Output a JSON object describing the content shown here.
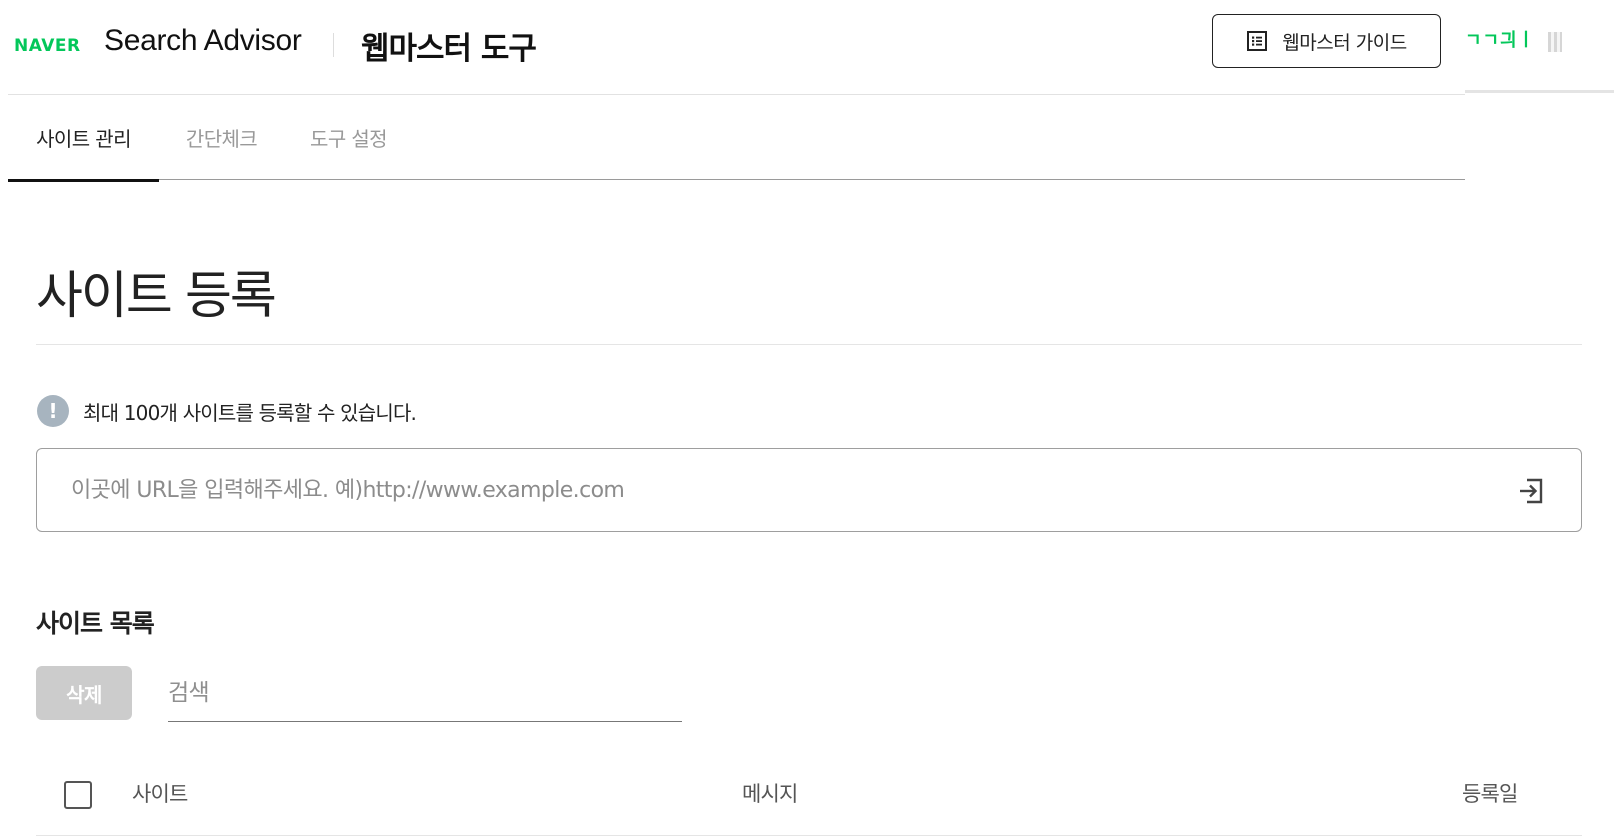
{
  "header": {
    "naver_logo": "NAVER",
    "app_name": "Search Advisor",
    "tool_title": "웹마스터 도구",
    "guide_button": "웹마스터 가이드",
    "guide_icon": "list-document-icon",
    "user_name": "ㄱㄱ긔ㅣ"
  },
  "tabs": [
    {
      "label": "사이트 관리",
      "active": true
    },
    {
      "label": "간단체크",
      "active": false
    },
    {
      "label": "도구 설정",
      "active": false
    }
  ],
  "main": {
    "title": "사이트 등록",
    "notice_icon": "!",
    "notice": "최대 100개 사이트를 등록할 수 있습니다.",
    "url_input": {
      "value": "",
      "placeholder": "이곳에 URL을 입력해주세요. 예)http://www.example.com"
    },
    "submit_icon": "enter-arrow-icon"
  },
  "site_list": {
    "title": "사이트 목록",
    "delete_button": "삭제",
    "search": {
      "value": "",
      "placeholder": "검색"
    },
    "columns": [
      "사이트",
      "메시지",
      "등록일"
    ],
    "rows": []
  },
  "colors": {
    "brand_green": "#03c75a",
    "disabled_gray": "#cccccc",
    "notice_icon_bg": "#a7b4bf"
  }
}
